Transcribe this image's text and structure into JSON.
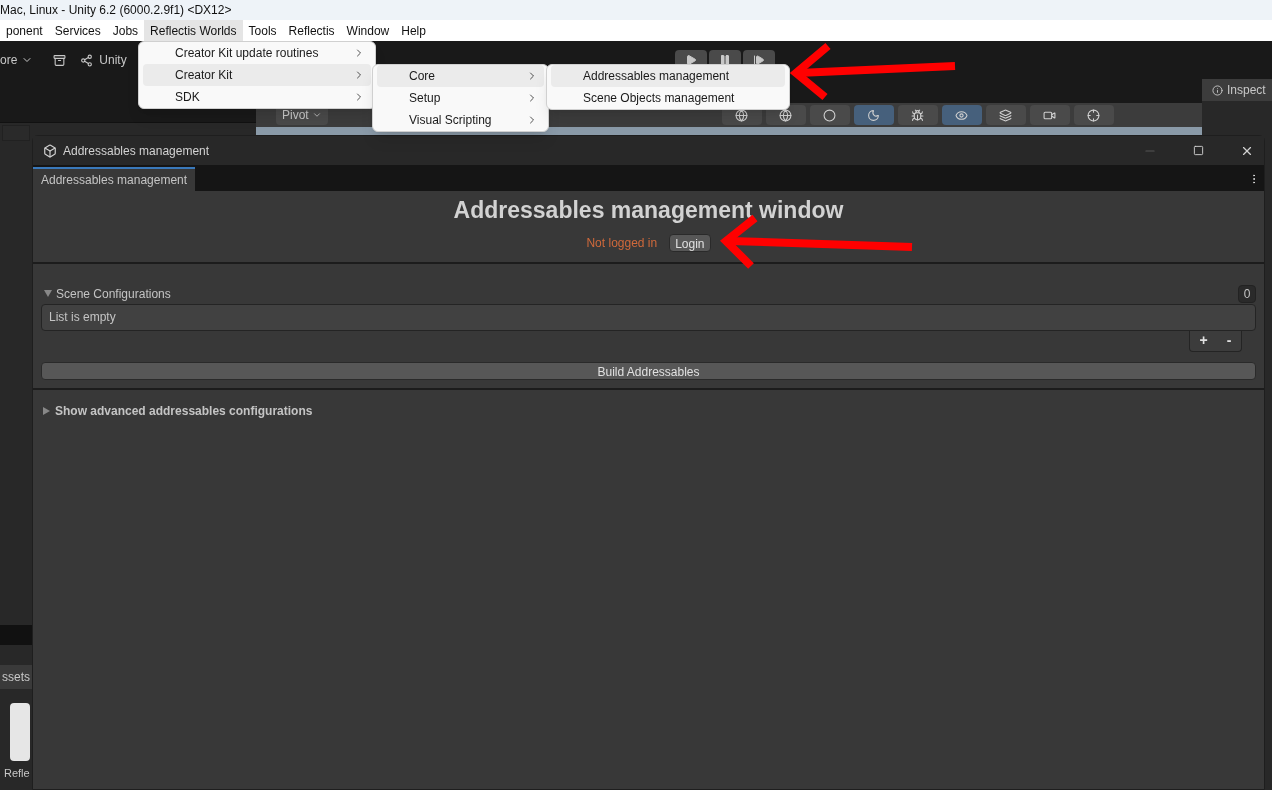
{
  "editor": {
    "title": "Mac, Linux - Unity 6.2 (6000.2.9f1) <DX12>",
    "menu_bar": [
      {
        "label": "ponent",
        "selected": false
      },
      {
        "label": "Services",
        "selected": false
      },
      {
        "label": "Jobs",
        "selected": false
      },
      {
        "label": "Reflectis Worlds",
        "selected": true
      },
      {
        "label": "Tools",
        "selected": false
      },
      {
        "label": "Reflectis",
        "selected": false
      },
      {
        "label": "Window",
        "selected": false
      },
      {
        "label": "Help",
        "selected": false
      }
    ],
    "toolbar": {
      "dropdown": "ore",
      "account": "Unity"
    },
    "scene_toolbar": {
      "pivot": "Pivot"
    },
    "inspector_tab": "Inspect",
    "project": {
      "tab": "ssets",
      "asset": "Refle"
    }
  },
  "menus": [
    {
      "items": [
        {
          "label": "Creator Kit update routines",
          "selected": false,
          "has_submenu": true
        },
        {
          "label": "Creator Kit",
          "selected": true,
          "has_submenu": true
        },
        {
          "label": "SDK",
          "selected": false,
          "has_submenu": true
        }
      ]
    },
    {
      "items": [
        {
          "label": "Core",
          "selected": true,
          "has_submenu": true
        },
        {
          "label": "Setup",
          "selected": false,
          "has_submenu": true
        },
        {
          "label": "Visual Scripting",
          "selected": false,
          "has_submenu": true
        }
      ]
    },
    {
      "items": [
        {
          "label": "Addressables management",
          "selected": true,
          "has_submenu": false
        },
        {
          "label": "Scene Objects management",
          "selected": false,
          "has_submenu": false
        }
      ]
    }
  ],
  "window": {
    "title": "Addressables management",
    "tab": "Addressables management",
    "heading": "Addressables management window",
    "login_status": "Not logged in",
    "login_button": "Login",
    "section": {
      "title": "Scene Configurations",
      "expanded": true,
      "count": "0",
      "empty_text": "List is empty"
    },
    "add_button": "+",
    "remove_button": "-",
    "build_button": "Build Addressables",
    "advanced": {
      "label": "Show advanced addressables configurations",
      "expanded": false
    }
  }
}
